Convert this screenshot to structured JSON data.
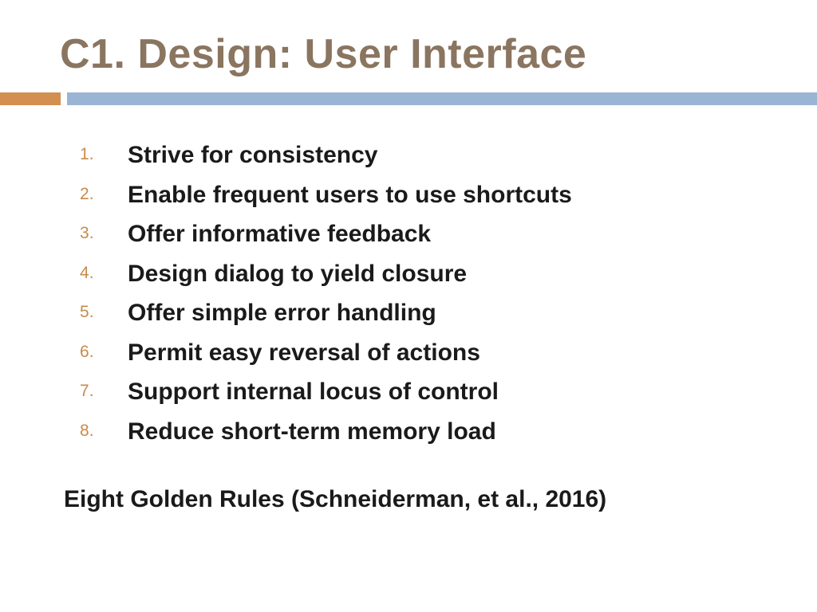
{
  "title": "C1. Design: User Interface",
  "rules": [
    "Strive for consistency",
    "Enable frequent users to use shortcuts",
    "Offer informative feedback",
    "Design dialog to yield closure",
    "Offer simple error handling",
    "Permit easy reversal of actions",
    "Support internal locus of control",
    "Reduce short-term memory load"
  ],
  "footer": "Eight Golden Rules (Schneiderman, et al., 2016)",
  "colors": {
    "title": "#8a7560",
    "accent_orange": "#d28f4f",
    "accent_blue": "#9ab5d3",
    "number": "#c98a4a"
  }
}
